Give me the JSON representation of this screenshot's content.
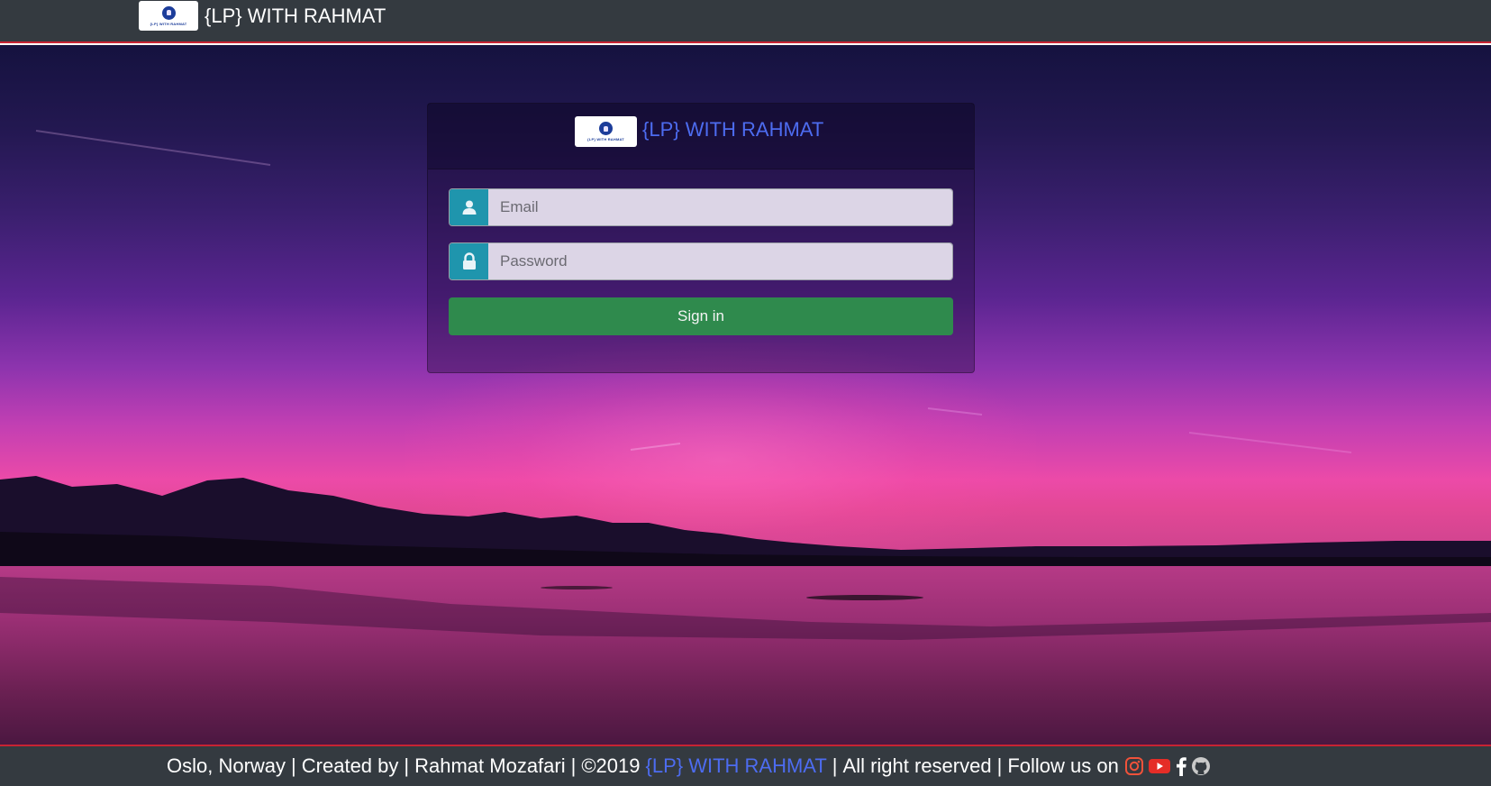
{
  "header": {
    "brand": "{LP} WITH RAHMAT",
    "logo_text": "{LP} WITH RAHMAT"
  },
  "login": {
    "brand": "{LP} WITH RAHMAT",
    "logo_text": "{LP} WITH RAHMAT",
    "email_placeholder": "Email",
    "password_placeholder": "Password",
    "signin_label": "Sign in",
    "icons": {
      "email": "user-icon",
      "password": "lock-icon"
    },
    "colors": {
      "addon": "#1f95ad",
      "signin": "#2f8a4d",
      "brand": "#4d6cf0"
    }
  },
  "footer": {
    "location": "Oslo, Norway",
    "created_by_label": "Created by",
    "author": "Rahmat Mozafari",
    "year": "©2019",
    "brand": "{LP} WITH RAHMAT",
    "rights": "All right reserved",
    "follow": "Follow us on",
    "sep": "|",
    "social": [
      "instagram-icon",
      "youtube-icon",
      "facebook-icon",
      "github-icon"
    ]
  }
}
